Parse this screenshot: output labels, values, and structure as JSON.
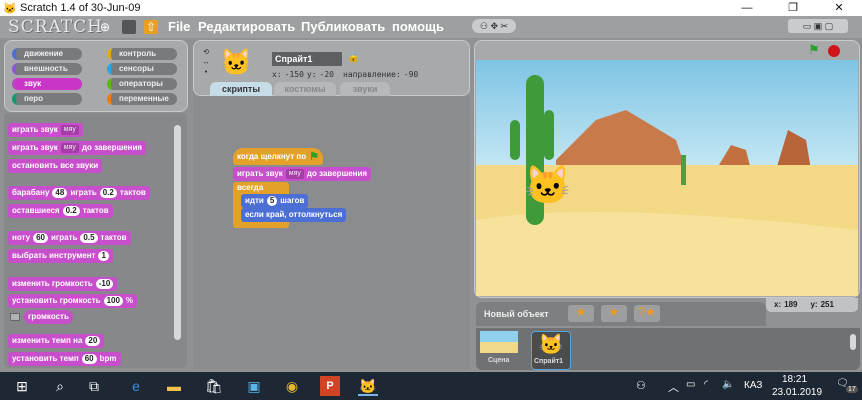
{
  "window": {
    "title": "Scratch 1.4 of 30-Jun-09",
    "minimize": "—",
    "maximize": "❐",
    "close": "✕"
  },
  "menubar": {
    "logo": "SCRATCH",
    "items": [
      "File",
      "Редактировать",
      "Публиковать",
      "помощь"
    ],
    "icons": [
      "globe-icon",
      "save-icon",
      "share-icon"
    ]
  },
  "categories": [
    {
      "label": "движение",
      "color": "#4a6cd4"
    },
    {
      "label": "контроль",
      "color": "#e1a91a"
    },
    {
      "label": "внешность",
      "color": "#8a55d7"
    },
    {
      "label": "сенсоры",
      "color": "#2ca5e2"
    },
    {
      "label": "звук",
      "color": "#bb42c3"
    },
    {
      "label": "операторы",
      "color": "#5cb712"
    },
    {
      "label": "перо",
      "color": "#0e9a6c"
    },
    {
      "label": "переменные",
      "color": "#ee7d16"
    }
  ],
  "palette": {
    "play_sound": "играть звук",
    "sound_name": "мяу",
    "until_done": "до завершения",
    "stop_all": "остановить все звуки",
    "drum": "барабану",
    "drum_val": "48",
    "play": "играть",
    "beats": "тактов",
    "beat_val": "0.2",
    "rest": "оставшиеся",
    "rest_val": "0.2",
    "note": "ноту",
    "note_val": "60",
    "note_beats": "0.5",
    "instrument": "выбрать инструмент",
    "instrument_val": "1",
    "change_vol": "изменить громкость",
    "change_vol_val": "-10",
    "set_vol": "установить громкость",
    "set_vol_val": "100",
    "percent": "%",
    "volume": "громкость",
    "change_tempo": "изменить темп на",
    "change_tempo_val": "20",
    "set_tempo": "установить темп",
    "set_tempo_val": "60",
    "bpm": "bpm"
  },
  "sprite": {
    "name": "Спрайт1",
    "x_label": "x:",
    "x": "-150",
    "y_label": "y:",
    "y": "-20",
    "dir_label": "направление:",
    "dir": "-90"
  },
  "tabs": [
    "скрипты",
    "костюмы",
    "звуки"
  ],
  "script": {
    "hat": "когда щелкнут по",
    "play_sound": "играть звук",
    "sound": "мяу",
    "until_done": "до завершения",
    "forever": "всегда",
    "move": "идти",
    "steps": "5",
    "steps_label": "шагов",
    "bounce": "если край, оттолкнуться"
  },
  "stage_info": {
    "x_label": "x:",
    "x": "189",
    "y_label": "y:",
    "y": "251",
    "new_sprite": "Новый объект"
  },
  "sprites_list": {
    "stage_label": "Сцена",
    "sprite_label": "Спрайт1"
  },
  "taskbar": {
    "lang": "КАЗ",
    "time": "18:21",
    "date": "23.01.2019",
    "notifications": "17"
  }
}
